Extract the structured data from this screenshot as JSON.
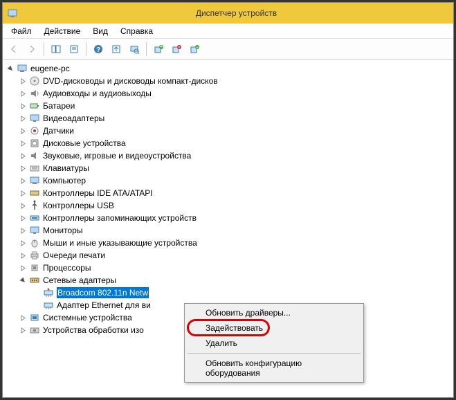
{
  "title": "Диспетчер устройств",
  "menu": {
    "file": "Файл",
    "action": "Действие",
    "view": "Вид",
    "help": "Справка"
  },
  "toolbar": {
    "back": "Назад",
    "forward": "Вперёд",
    "show_hide": "Показать/скрыть дерево",
    "properties": "Свойства",
    "help": "Справка",
    "up": "Вверх",
    "refresh": "Обновить конфигурацию",
    "update_driver": "Обновить драйвер",
    "disable": "Задействовать",
    "uninstall": "Удалить"
  },
  "root": {
    "label": "eugene-pc"
  },
  "categories": [
    {
      "label": "DVD-дисководы и дисководы компакт-дисков",
      "icon": "disc-icon"
    },
    {
      "label": "Аудиовходы и аудиовыходы",
      "icon": "audio-icon"
    },
    {
      "label": "Батареи",
      "icon": "battery-icon"
    },
    {
      "label": "Видеоадаптеры",
      "icon": "display-icon"
    },
    {
      "label": "Датчики",
      "icon": "sensor-icon"
    },
    {
      "label": "Дисковые устройства",
      "icon": "hdd-icon"
    },
    {
      "label": "Звуковые, игровые и видеоустройства",
      "icon": "sound-icon"
    },
    {
      "label": "Клавиатуры",
      "icon": "keyboard-icon"
    },
    {
      "label": "Компьютер",
      "icon": "computer-icon"
    },
    {
      "label": "Контроллеры IDE ATA/ATAPI",
      "icon": "ide-icon"
    },
    {
      "label": "Контроллеры USB",
      "icon": "usb-icon"
    },
    {
      "label": "Контроллеры запоминающих устройств",
      "icon": "storagectl-icon"
    },
    {
      "label": "Мониторы",
      "icon": "monitor-icon"
    },
    {
      "label": "Мыши и иные указывающие устройства",
      "icon": "mouse-icon"
    },
    {
      "label": "Очереди печати",
      "icon": "printer-icon"
    },
    {
      "label": "Процессоры",
      "icon": "cpu-icon"
    }
  ],
  "network": {
    "label": "Сетевые адаптеры",
    "items": [
      {
        "label": "Broadcom 802.11n Netw",
        "selected": true
      },
      {
        "label": "Адаптер Ethernet для ви"
      }
    ]
  },
  "tail": [
    {
      "label": "Системные устройства",
      "icon": "system-icon"
    },
    {
      "label": "Устройства обработки изо",
      "icon": "imaging-icon"
    }
  ],
  "context": {
    "update": "Обновить драйверы...",
    "enable": "Задействовать",
    "delete": "Удалить",
    "refresh": "Обновить конфигурацию оборудования"
  }
}
